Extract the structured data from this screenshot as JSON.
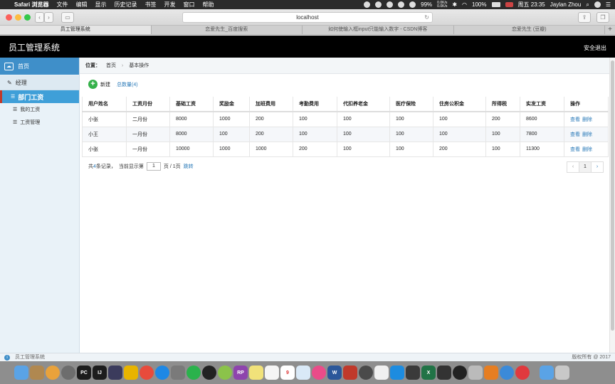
{
  "menubar": {
    "app_name": "Safari 浏览器",
    "items": [
      "文件",
      "编辑",
      "显示",
      "历史记录",
      "书签",
      "开发",
      "窗口",
      "帮助"
    ],
    "battery": "99%",
    "net_up": "0.0K/s",
    "net_down": "0.0K/s",
    "battery2": "100%",
    "clock": "周五 23:35",
    "user": "Jaylan Zhou"
  },
  "browser": {
    "url": "localhost",
    "tabs": [
      "员工管理系统",
      "恋爱先生_百度搜索",
      "如何使输入框input只能输入数字 - CSDN博客",
      "恋爱先生 (豆瓣)"
    ]
  },
  "app": {
    "title": "员工管理系统",
    "logout": "安全退出"
  },
  "sidebar": {
    "home": "首页",
    "section": "经理",
    "items": [
      "部门工资",
      "我的工资",
      "工资管理"
    ]
  },
  "breadcrumb": {
    "prefix": "位置：",
    "home": "首页",
    "sep": "›",
    "current": "基本操作"
  },
  "actions": {
    "new_label": "新建",
    "count_label": "总数量(4)"
  },
  "table": {
    "headers": [
      "用户姓名",
      "工资月份",
      "基础工资",
      "奖励金",
      "加班费用",
      "考勤费用",
      "代扣养老金",
      "医疗保险",
      "住房公积金",
      "所得税",
      "实发工资",
      "操作"
    ],
    "rows": [
      [
        "小张",
        "二月份",
        "8000",
        "1000",
        "200",
        "100",
        "100",
        "100",
        "100",
        "200",
        "8600"
      ],
      [
        "小王",
        "一月份",
        "8000",
        "100",
        "200",
        "100",
        "100",
        "100",
        "100",
        "100",
        "7800"
      ],
      [
        "小张",
        "一月份",
        "10000",
        "1000",
        "1000",
        "200",
        "100",
        "100",
        "200",
        "100",
        "11300"
      ]
    ],
    "view_label": "查看",
    "delete_label": "删除"
  },
  "pager": {
    "total_prefix": "共",
    "total": "4",
    "total_suffix": "条记录，",
    "current_prefix": "当前显示第",
    "page_value": "1",
    "page_suffix": "页 / 1页",
    "jump": "跳转",
    "prev": "‹",
    "current": "1",
    "next": "›"
  },
  "statusbar": {
    "left": "员工管理系统",
    "right": "版权所有 @ 2017"
  },
  "colors": {
    "header_bg": "#000000",
    "sidebar_active": "#3f9fd8",
    "link": "#2a7ab8",
    "new_button": "#35b14a"
  }
}
